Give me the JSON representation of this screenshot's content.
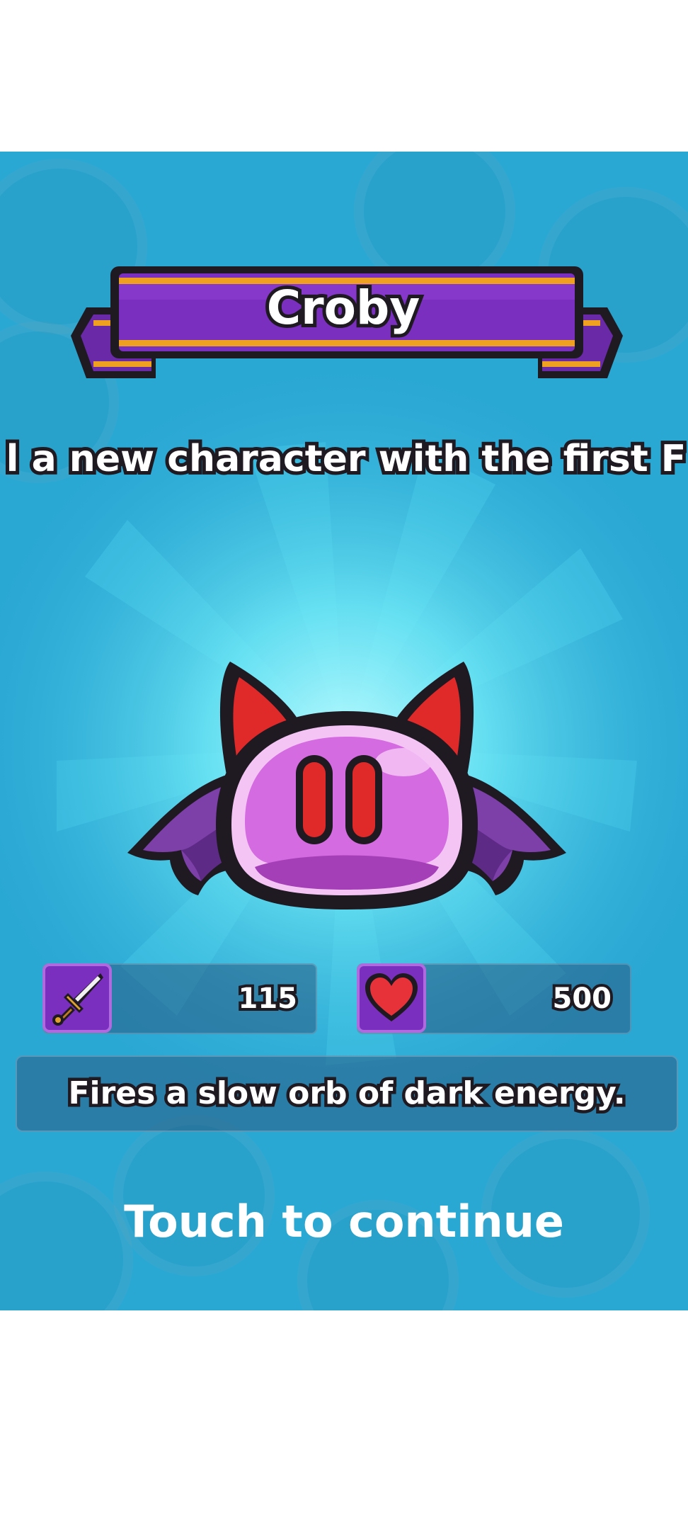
{
  "unlock": {
    "character_name": "Croby",
    "subtitle": "l a new character with the first F",
    "attack_value": "115",
    "health_value": "500",
    "description": "Fires a slow orb of dark energy.",
    "continue_prompt": "Touch to continue"
  },
  "icons": {
    "attack": "sword-icon",
    "health": "heart-icon"
  },
  "colors": {
    "background": "#2aa8d4",
    "ribbon": "#7b2fbe",
    "ribbon_trim": "#f0a020",
    "heart": "#e8323a",
    "stat_icon_bg": "#7b2fbe"
  }
}
